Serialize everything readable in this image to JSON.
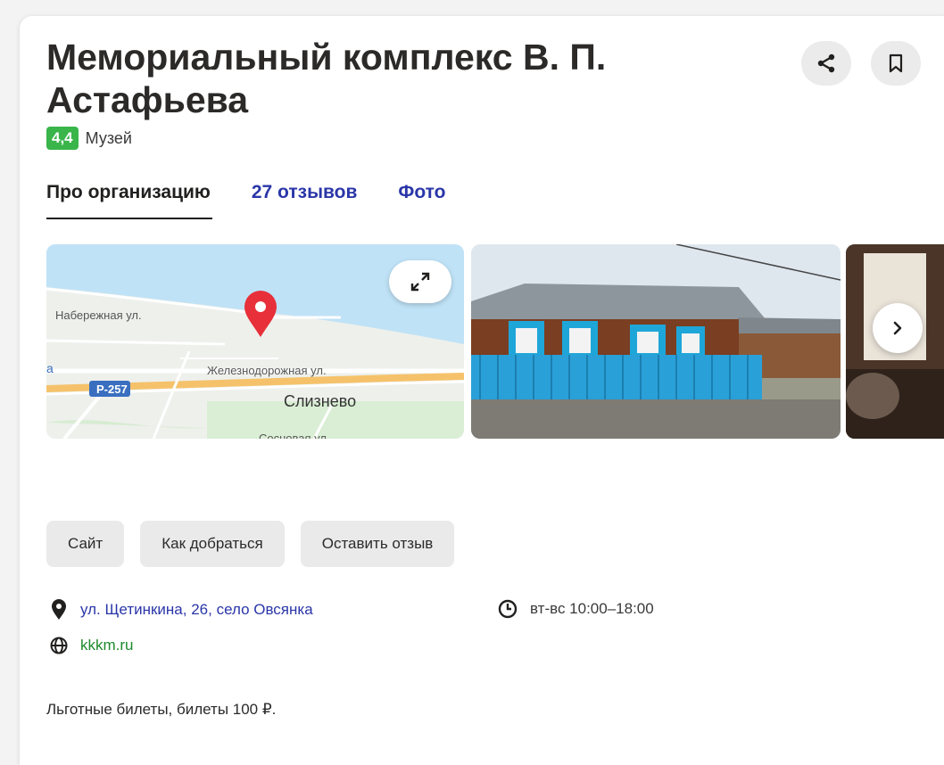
{
  "header": {
    "title": "Мемориальный комплекс В. П. Астафьева",
    "rating": "4,4",
    "category": "Музей",
    "share_icon": "share-icon",
    "bookmark_icon": "bookmark-icon"
  },
  "tabs": [
    {
      "label": "Про организацию",
      "active": true
    },
    {
      "label": "27 отзывов",
      "active": false
    },
    {
      "label": "Фото",
      "active": false
    }
  ],
  "map": {
    "street1": "Набережная ул.",
    "street2": "Железнодорожная ул.",
    "street3": "Сосновая ул.",
    "road": "Р-257",
    "village": "Слизнево",
    "edge_letter": "а",
    "pin_icon": "map-pin-icon",
    "expand_icon": "expand-icon"
  },
  "actions": {
    "site": "Сайт",
    "directions": "Как добраться",
    "review": "Оставить отзыв"
  },
  "info": {
    "address": "ул. Щетинкина, 26, село Овсянка",
    "hours": "вт-вс 10:00–18:00",
    "website": "kkkm.ru"
  },
  "note": "Льготные билеты, билеты 100 ₽.",
  "colors": {
    "rating_bg": "#39b54a",
    "link_blue": "#2a36a8",
    "link_green": "#1d8a2c",
    "pin_red": "#e8303a"
  }
}
